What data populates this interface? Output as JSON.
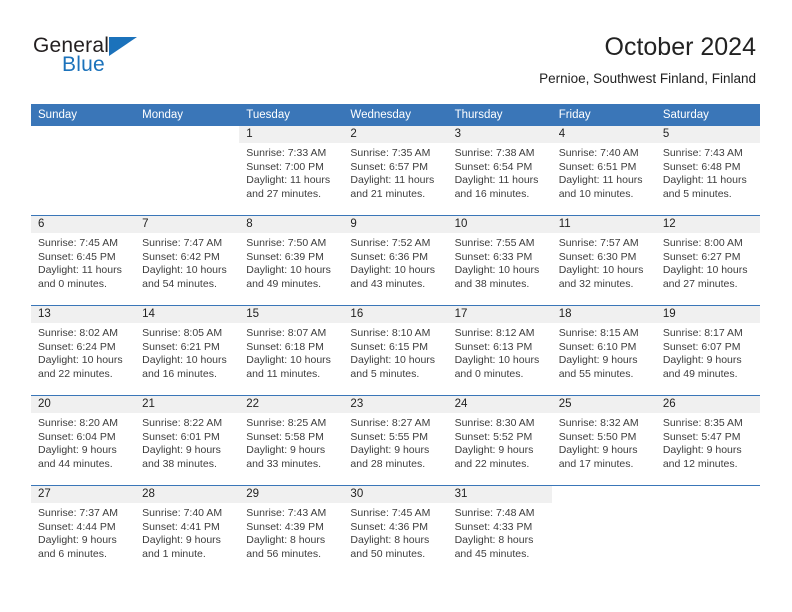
{
  "brand": {
    "word_one": "General",
    "word_two": "Blue",
    "triangle_icon": "brand-triangle-icon",
    "accent_color": "#1b72bb"
  },
  "header": {
    "title": "October 2024",
    "subtitle": "Pernioe, Southwest Finland, Finland"
  },
  "theme": {
    "header_blue": "#3a76b8",
    "daynum_band": "#f0f0f0",
    "text": "#3d3d3d"
  },
  "calendar": {
    "weekday_headers": [
      "Sunday",
      "Monday",
      "Tuesday",
      "Wednesday",
      "Thursday",
      "Friday",
      "Saturday"
    ],
    "weeks": [
      [
        {
          "day": "",
          "sunrise": "",
          "sunset": "",
          "daylight_line1": "",
          "daylight_line2": "",
          "blank": true
        },
        {
          "day": "",
          "sunrise": "",
          "sunset": "",
          "daylight_line1": "",
          "daylight_line2": "",
          "blank": true
        },
        {
          "day": "1",
          "sunrise": "Sunrise: 7:33 AM",
          "sunset": "Sunset: 7:00 PM",
          "daylight_line1": "Daylight: 11 hours",
          "daylight_line2": "and 27 minutes."
        },
        {
          "day": "2",
          "sunrise": "Sunrise: 7:35 AM",
          "sunset": "Sunset: 6:57 PM",
          "daylight_line1": "Daylight: 11 hours",
          "daylight_line2": "and 21 minutes."
        },
        {
          "day": "3",
          "sunrise": "Sunrise: 7:38 AM",
          "sunset": "Sunset: 6:54 PM",
          "daylight_line1": "Daylight: 11 hours",
          "daylight_line2": "and 16 minutes."
        },
        {
          "day": "4",
          "sunrise": "Sunrise: 7:40 AM",
          "sunset": "Sunset: 6:51 PM",
          "daylight_line1": "Daylight: 11 hours",
          "daylight_line2": "and 10 minutes."
        },
        {
          "day": "5",
          "sunrise": "Sunrise: 7:43 AM",
          "sunset": "Sunset: 6:48 PM",
          "daylight_line1": "Daylight: 11 hours",
          "daylight_line2": "and 5 minutes."
        }
      ],
      [
        {
          "day": "6",
          "sunrise": "Sunrise: 7:45 AM",
          "sunset": "Sunset: 6:45 PM",
          "daylight_line1": "Daylight: 11 hours",
          "daylight_line2": "and 0 minutes."
        },
        {
          "day": "7",
          "sunrise": "Sunrise: 7:47 AM",
          "sunset": "Sunset: 6:42 PM",
          "daylight_line1": "Daylight: 10 hours",
          "daylight_line2": "and 54 minutes."
        },
        {
          "day": "8",
          "sunrise": "Sunrise: 7:50 AM",
          "sunset": "Sunset: 6:39 PM",
          "daylight_line1": "Daylight: 10 hours",
          "daylight_line2": "and 49 minutes."
        },
        {
          "day": "9",
          "sunrise": "Sunrise: 7:52 AM",
          "sunset": "Sunset: 6:36 PM",
          "daylight_line1": "Daylight: 10 hours",
          "daylight_line2": "and 43 minutes."
        },
        {
          "day": "10",
          "sunrise": "Sunrise: 7:55 AM",
          "sunset": "Sunset: 6:33 PM",
          "daylight_line1": "Daylight: 10 hours",
          "daylight_line2": "and 38 minutes."
        },
        {
          "day": "11",
          "sunrise": "Sunrise: 7:57 AM",
          "sunset": "Sunset: 6:30 PM",
          "daylight_line1": "Daylight: 10 hours",
          "daylight_line2": "and 32 minutes."
        },
        {
          "day": "12",
          "sunrise": "Sunrise: 8:00 AM",
          "sunset": "Sunset: 6:27 PM",
          "daylight_line1": "Daylight: 10 hours",
          "daylight_line2": "and 27 minutes."
        }
      ],
      [
        {
          "day": "13",
          "sunrise": "Sunrise: 8:02 AM",
          "sunset": "Sunset: 6:24 PM",
          "daylight_line1": "Daylight: 10 hours",
          "daylight_line2": "and 22 minutes."
        },
        {
          "day": "14",
          "sunrise": "Sunrise: 8:05 AM",
          "sunset": "Sunset: 6:21 PM",
          "daylight_line1": "Daylight: 10 hours",
          "daylight_line2": "and 16 minutes."
        },
        {
          "day": "15",
          "sunrise": "Sunrise: 8:07 AM",
          "sunset": "Sunset: 6:18 PM",
          "daylight_line1": "Daylight: 10 hours",
          "daylight_line2": "and 11 minutes."
        },
        {
          "day": "16",
          "sunrise": "Sunrise: 8:10 AM",
          "sunset": "Sunset: 6:15 PM",
          "daylight_line1": "Daylight: 10 hours",
          "daylight_line2": "and 5 minutes."
        },
        {
          "day": "17",
          "sunrise": "Sunrise: 8:12 AM",
          "sunset": "Sunset: 6:13 PM",
          "daylight_line1": "Daylight: 10 hours",
          "daylight_line2": "and 0 minutes."
        },
        {
          "day": "18",
          "sunrise": "Sunrise: 8:15 AM",
          "sunset": "Sunset: 6:10 PM",
          "daylight_line1": "Daylight: 9 hours",
          "daylight_line2": "and 55 minutes."
        },
        {
          "day": "19",
          "sunrise": "Sunrise: 8:17 AM",
          "sunset": "Sunset: 6:07 PM",
          "daylight_line1": "Daylight: 9 hours",
          "daylight_line2": "and 49 minutes."
        }
      ],
      [
        {
          "day": "20",
          "sunrise": "Sunrise: 8:20 AM",
          "sunset": "Sunset: 6:04 PM",
          "daylight_line1": "Daylight: 9 hours",
          "daylight_line2": "and 44 minutes."
        },
        {
          "day": "21",
          "sunrise": "Sunrise: 8:22 AM",
          "sunset": "Sunset: 6:01 PM",
          "daylight_line1": "Daylight: 9 hours",
          "daylight_line2": "and 38 minutes."
        },
        {
          "day": "22",
          "sunrise": "Sunrise: 8:25 AM",
          "sunset": "Sunset: 5:58 PM",
          "daylight_line1": "Daylight: 9 hours",
          "daylight_line2": "and 33 minutes."
        },
        {
          "day": "23",
          "sunrise": "Sunrise: 8:27 AM",
          "sunset": "Sunset: 5:55 PM",
          "daylight_line1": "Daylight: 9 hours",
          "daylight_line2": "and 28 minutes."
        },
        {
          "day": "24",
          "sunrise": "Sunrise: 8:30 AM",
          "sunset": "Sunset: 5:52 PM",
          "daylight_line1": "Daylight: 9 hours",
          "daylight_line2": "and 22 minutes."
        },
        {
          "day": "25",
          "sunrise": "Sunrise: 8:32 AM",
          "sunset": "Sunset: 5:50 PM",
          "daylight_line1": "Daylight: 9 hours",
          "daylight_line2": "and 17 minutes."
        },
        {
          "day": "26",
          "sunrise": "Sunrise: 8:35 AM",
          "sunset": "Sunset: 5:47 PM",
          "daylight_line1": "Daylight: 9 hours",
          "daylight_line2": "and 12 minutes."
        }
      ],
      [
        {
          "day": "27",
          "sunrise": "Sunrise: 7:37 AM",
          "sunset": "Sunset: 4:44 PM",
          "daylight_line1": "Daylight: 9 hours",
          "daylight_line2": "and 6 minutes."
        },
        {
          "day": "28",
          "sunrise": "Sunrise: 7:40 AM",
          "sunset": "Sunset: 4:41 PM",
          "daylight_line1": "Daylight: 9 hours",
          "daylight_line2": "and 1 minute."
        },
        {
          "day": "29",
          "sunrise": "Sunrise: 7:43 AM",
          "sunset": "Sunset: 4:39 PM",
          "daylight_line1": "Daylight: 8 hours",
          "daylight_line2": "and 56 minutes."
        },
        {
          "day": "30",
          "sunrise": "Sunrise: 7:45 AM",
          "sunset": "Sunset: 4:36 PM",
          "daylight_line1": "Daylight: 8 hours",
          "daylight_line2": "and 50 minutes."
        },
        {
          "day": "31",
          "sunrise": "Sunrise: 7:48 AM",
          "sunset": "Sunset: 4:33 PM",
          "daylight_line1": "Daylight: 8 hours",
          "daylight_line2": "and 45 minutes."
        },
        {
          "day": "",
          "sunrise": "",
          "sunset": "",
          "daylight_line1": "",
          "daylight_line2": "",
          "blank": true
        },
        {
          "day": "",
          "sunrise": "",
          "sunset": "",
          "daylight_line1": "",
          "daylight_line2": "",
          "blank": true
        }
      ]
    ]
  }
}
